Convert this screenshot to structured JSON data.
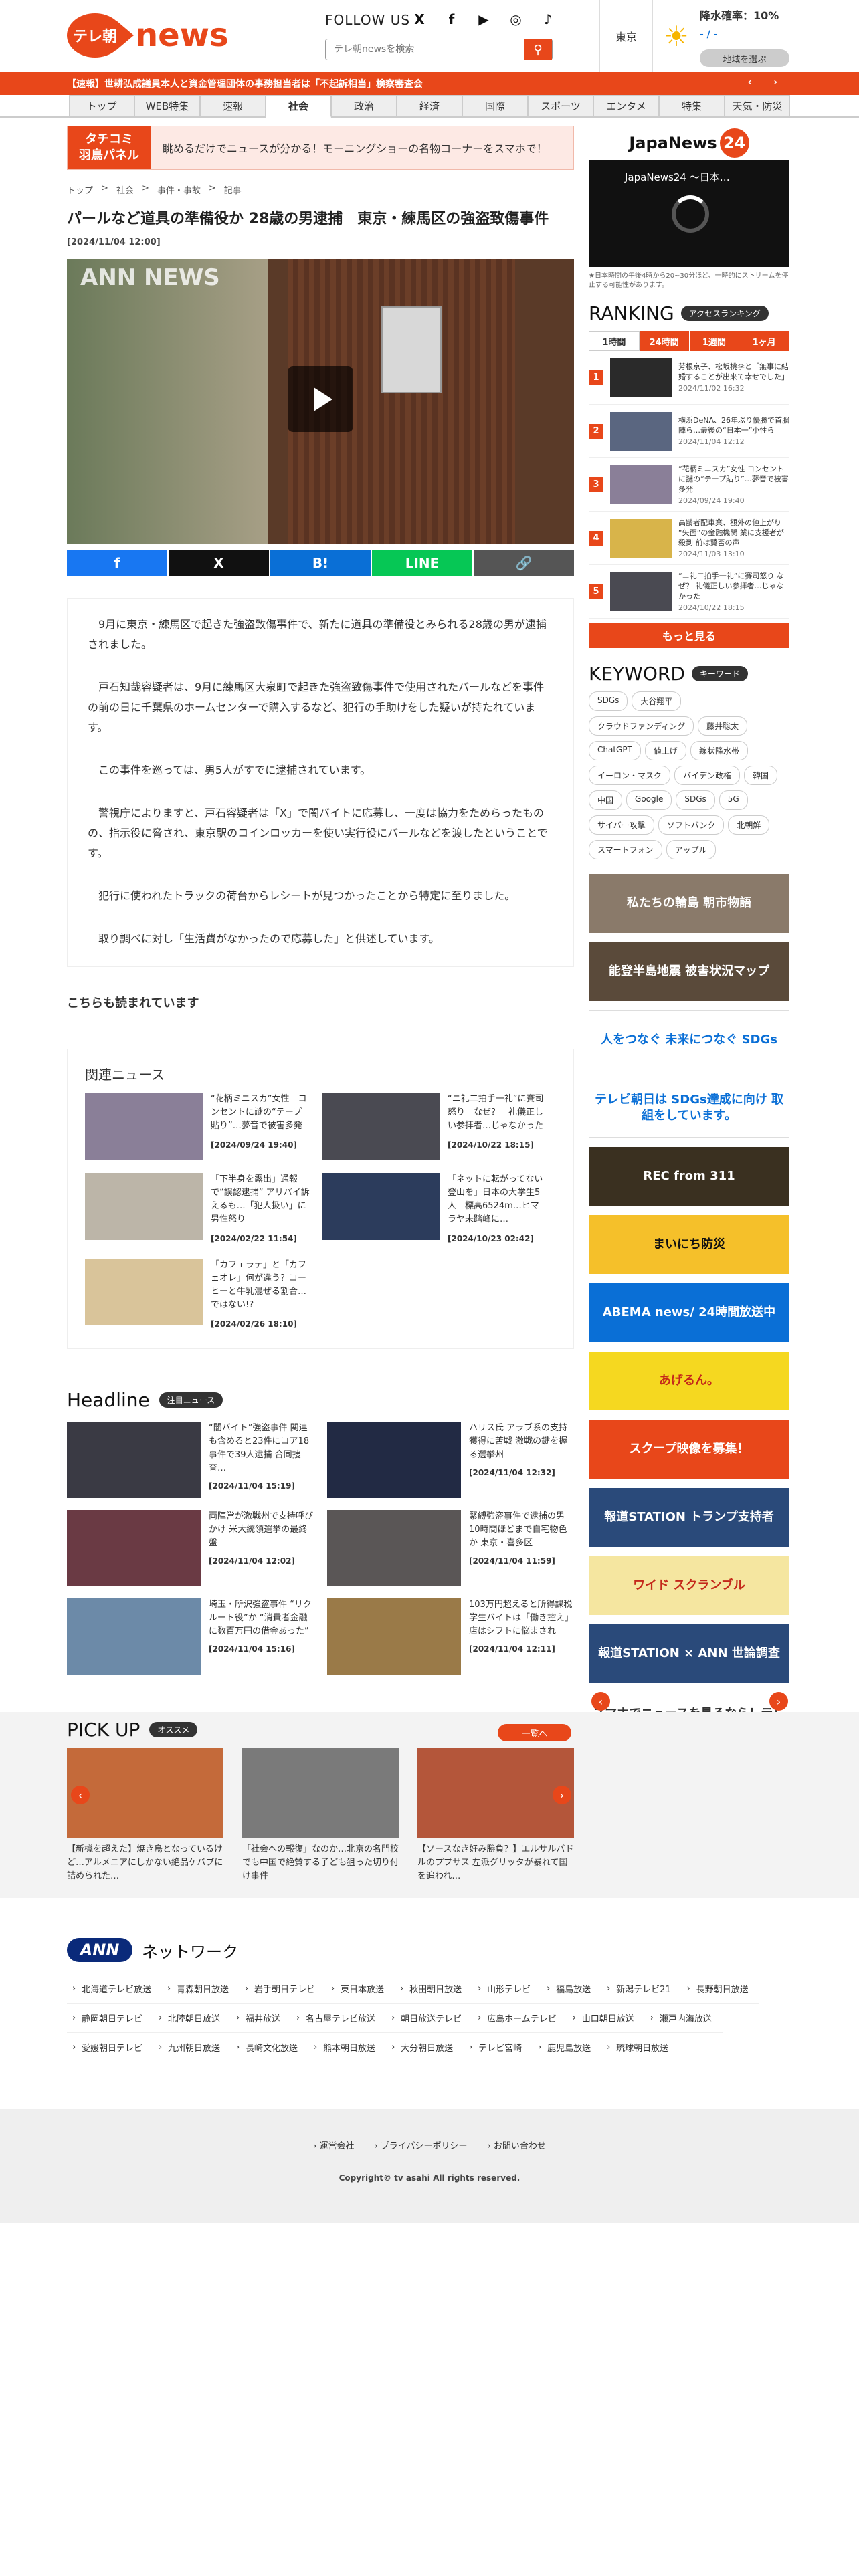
{
  "header": {
    "logo_badge": "テレ朝",
    "logo_text": "news",
    "follow_us": "FOLLOW US",
    "sns": [
      "X",
      "f",
      "▶",
      "◎",
      "♪"
    ],
    "search_placeholder": "テレ朝newsを検索",
    "weather": {
      "city": "東京",
      "rain": "降水確率：10%",
      "temps": "- / -",
      "select": "地域を選ぶ"
    }
  },
  "breaking": {
    "text": "【速報】世耕弘成議員本人と資金管理団体の事務担当者は「不起訴相当」検察審査会",
    "arrows": "‹ ›"
  },
  "nav": [
    "トップ",
    "WEB特集",
    "速報",
    "社会",
    "政治",
    "経済",
    "国際",
    "スポーツ",
    "エンタメ",
    "特集",
    "天気・防災"
  ],
  "banner": {
    "label_top": "タチコミ",
    "label_bottom": "羽鳥パネル",
    "text": "眺めるだけでニュースが分かる！モーニングショーの名物コーナーをスマホで！"
  },
  "breadcrumb": [
    "トップ",
    ">",
    "社会",
    ">",
    "事件・事故",
    ">",
    "記事"
  ],
  "article": {
    "title": "パールなど道具の準備役か 28歳の男逮捕　東京・練馬区の強盗致傷事件",
    "date": "[2024/11/04 12:00]",
    "video_badge": "ANN NEWS",
    "share": [
      "f",
      "X",
      "B!",
      "LINE",
      "🔗"
    ],
    "paragraphs": [
      "9月に東京・練馬区で起きた強盗致傷事件で、新たに道具の準備役とみられる28歳の男が逮捕されました。",
      "戸石知哉容疑者は、9月に練馬区大泉町で起きた強盗致傷事件で使用されたバールなどを事件の前の日に千葉県のホームセンターで購入するなど、犯行の手助けをした疑いが持たれています。",
      "この事件を巡っては、男5人がすでに逮捕されています。",
      "警視庁によりますと、戸石容疑者は「X」で闇バイトに応募し、一度は協力をためらったものの、指示役に脅され、東京駅のコインロッカーを使い実行役にバールなどを渡したということです。",
      "犯行に使われたトラックの荷台からレシートが見つかったことから特定に至りました。",
      "取り調べに対し「生活費がなかったので応募した」と供述しています。"
    ]
  },
  "must_read": "こちらも読まれています",
  "related": {
    "title": "関連ニュース",
    "items": [
      {
        "text": "“花柄ミニスカ”女性　コンセントに謎の“テープ貼り”…夢音で被害多発",
        "date": "[2024/09/24 19:40]",
        "color": "#8a7f98"
      },
      {
        "text": "“ニ礼二拍手一礼”に賽司怒り　なぜ？　礼儀正しい参拝者…じゃなかった",
        "date": "[2024/10/22 18:15]",
        "color": "#4a4a52"
      },
      {
        "text": "「下半身を露出」通報で“誤認逮捕” アリバイ訴えるも…「犯人扱い」に男性怒り",
        "date": "[2024/02/22 11:54]",
        "color": "#bcb5a8"
      },
      {
        "text": "「ネットに転がってない登山を」日本の大学生5人　標高6524m…ヒマラヤ未踏峰に…",
        "date": "[2024/10/23 02:42]",
        "color": "#2c3c5c"
      },
      {
        "text": "「カフェラテ」と「カフェオレ」何が違う？コーヒーと牛乳混ぜる割合…ではない!?",
        "date": "[2024/02/26 18:10]",
        "color": "#d9c49a"
      }
    ]
  },
  "headline": {
    "title": "Headline",
    "tag": "注目ニュース",
    "items": [
      {
        "text": "“闇バイト”強盗事件 関連も含めると23件にコア18事件で39人逮捕 合同捜査…",
        "date": "[2024/11/04 15:19]",
        "color": "#3a3a44"
      },
      {
        "text": "ハリス氏 アラブ系の支持獲得に苦戦 激戦の鍵を握る選挙州",
        "date": "[2024/11/04 12:32]",
        "color": "#222a44"
      },
      {
        "text": "両陣営が激戦州で支持呼びかけ 米大統領選挙の最終盤",
        "date": "[2024/11/04 12:02]",
        "color": "#6a3a44"
      },
      {
        "text": "緊縛強盗事件で逮捕の男 10時間ほどまで自宅物色か 東京・喜多区",
        "date": "[2024/11/04 11:59]",
        "color": "#5a5656"
      },
      {
        "text": "埼玉・所沢強盗事件 “リクルート役”か “消費者金融に数百万円の借金あった”",
        "date": "[2024/11/04 15:16]",
        "color": "#6c8aa8"
      },
      {
        "text": "103万円超えると所得課税 学生バイトは「働き控え」店はシフトに悩まされ",
        "date": "[2024/11/04 12:11]",
        "color": "#9a7a48"
      }
    ]
  },
  "pickup": {
    "title": "PICK UP",
    "tag": "オススメ",
    "more": "一覧へ",
    "items": [
      {
        "text": "【新機を超えた】焼き鳥となっているけど…アルメニアにしかない絶品ケバブに詰められた…",
        "color": "#c46a3a"
      },
      {
        "text": "「社会への報復」なのか…北京の名門校でも中国で絶賛する子ども狙った切り付け事件",
        "color": "#7a7a7a"
      },
      {
        "text": "【ソースなき好み勝負？】エルサルバドルのププサス 左派グリッタが暴れて国を追われ…",
        "color": "#b4563a"
      }
    ]
  },
  "network": {
    "logo": "ANN",
    "title": "ネットワーク",
    "stations": [
      "北海道テレビ放送",
      "青森朝日放送",
      "岩手朝日テレビ",
      "東日本放送",
      "秋田朝日放送",
      "山形テレビ",
      "福島放送",
      "新潟テレビ21",
      "長野朝日放送",
      "静岡朝日テレビ",
      "北陸朝日放送",
      "福井放送",
      "名古屋テレビ放送",
      "朝日放送テレビ",
      "広島ホームテレビ",
      "山口朝日放送",
      "瀬戸内海放送",
      "愛媛朝日テレビ",
      "九州朝日放送",
      "長崎文化放送",
      "熊本朝日放送",
      "大分朝日放送",
      "テレビ宮崎",
      "鹿児島放送",
      "琉球朝日放送"
    ]
  },
  "footer": {
    "links": [
      "› 運営会社",
      "› プライバシーポリシー",
      "› お問い合わせ"
    ],
    "copyright": "Copyright© tv asahi All rights reserved."
  },
  "sidebar": {
    "jp24_text": "JapaNews",
    "jp24_num": "24",
    "player_title": "JapaNews24 ～日本…",
    "note": "★日本時間の午後4時から20~30分ほど、一時的にストリームを停止する可能性があります。",
    "ranking_title": "RANKING",
    "ranking_tag": "アクセスランキング",
    "tabs": [
      "1時間",
      "24時間",
      "1週間",
      "1ヶ月"
    ],
    "ranking": [
      {
        "n": "1",
        "text": "芳根京子、松坂桃李と「無事に結婚することが出来て幸せでした」",
        "date": "2024/11/02 16:32",
        "color": "#2a2a2a"
      },
      {
        "n": "2",
        "text": "横浜DeNA、26年ぶり優勝で首脳陣ら…最後の“日本一”小性ら",
        "date": "2024/11/04 12:12",
        "color": "#5a6680"
      },
      {
        "n": "3",
        "text": "“花柄ミニスカ”女性 コンセントに謎の“テープ貼り”…夢音で被害多発",
        "date": "2024/09/24 19:40",
        "color": "#8a7f98"
      },
      {
        "n": "4",
        "text": "高齢者配車業、額外の値上がり “矢面”の金融機関 業に支援者が殺到 前は賛否の声",
        "date": "2024/11/03 13:10",
        "color": "#d8b44a"
      },
      {
        "n": "5",
        "text": "“ニ礼二拍手一礼”に賽司怒り なぜ？ 礼儀正しい参拝者…じゃなかった",
        "date": "2024/10/22 18:15",
        "color": "#4a4a52"
      }
    ],
    "more": "もっと見る",
    "keyword_title": "KEYWORD",
    "keyword_tag": "キーワード",
    "keywords": [
      "SDGs",
      "大谷翔平",
      "クラウドファンディング",
      "藤井聡太",
      "ChatGPT",
      "値上げ",
      "線状降水帯",
      "イーロン・マスク",
      "バイデン政権",
      "韓国",
      "中国",
      "Google",
      "SDGs",
      "5G",
      "サイバー攻撃",
      "ソフトバンク",
      "北朝鮮",
      "スマートフォン",
      "アップル"
    ],
    "banners": [
      {
        "text": "私たちの輪島 朝市物語",
        "bg": "#8a7a6a",
        "fg": "#fff"
      },
      {
        "text": "能登半島地震 被害状況マップ",
        "bg": "#5a4a3a",
        "fg": "#fff"
      },
      {
        "text": "人をつなぐ 未来につなぐ SDGs",
        "bg": "#ffffff",
        "fg": "#0a6fd6"
      },
      {
        "text": "テレビ朝日は SDGs達成に向け 取組をしています。",
        "bg": "#ffffff",
        "fg": "#0a6fd6"
      },
      {
        "text": "REC from 311",
        "bg": "#3a3020",
        "fg": "#fff"
      },
      {
        "text": "まいにち防災",
        "bg": "#f5c02a",
        "fg": "#111"
      },
      {
        "text": "ABEMA news/ 24時間放送中",
        "bg": "#0a6fd6",
        "fg": "#fff"
      },
      {
        "text": "あげるん。",
        "bg": "#f5d820",
        "fg": "#c4281a"
      },
      {
        "text": "スクープ映像を募集！",
        "bg": "#e8471a",
        "fg": "#fff"
      },
      {
        "text": "報道STATION トランプ支持者",
        "bg": "#2a4a7a",
        "fg": "#fff"
      },
      {
        "text": "ワイド スクランブル",
        "bg": "#f5e6a0",
        "fg": "#c4281a"
      },
      {
        "text": "報道STATION × ANN 世論調査",
        "bg": "#2a4a7a",
        "fg": "#fff"
      },
      {
        "text": "スマホでニュースを見るなら！テレ朝newsアプリ",
        "bg": "#ffffff",
        "fg": "#333"
      }
    ]
  }
}
